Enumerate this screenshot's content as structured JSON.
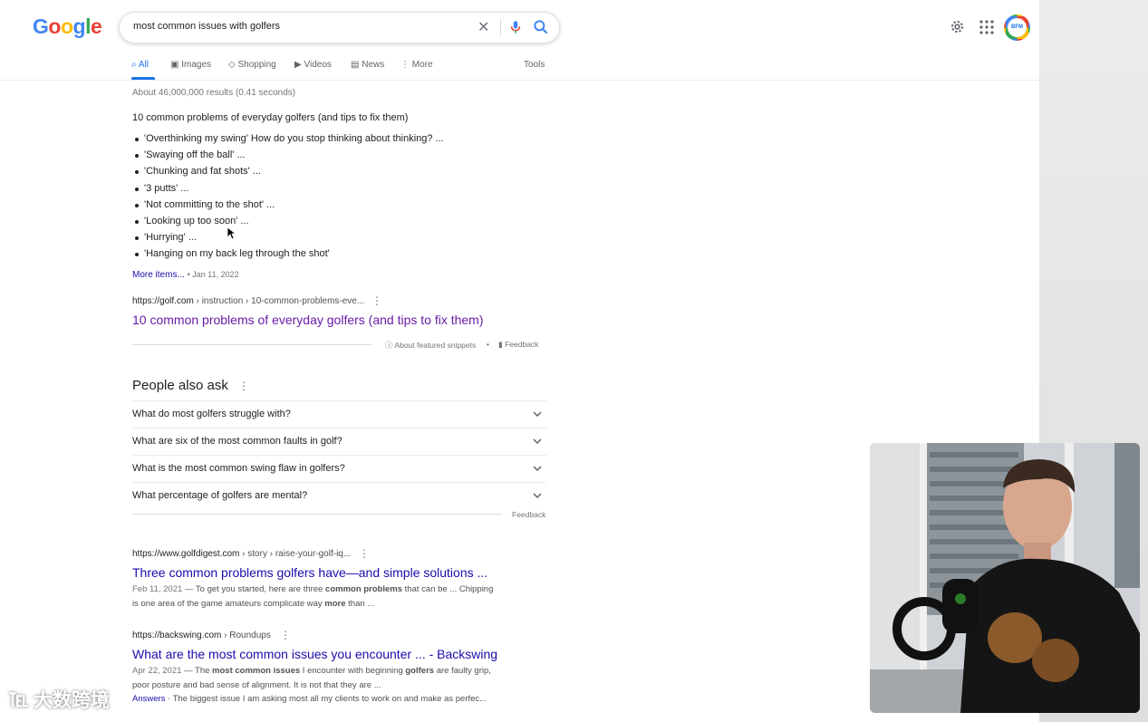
{
  "logo": {
    "letters": [
      "G",
      "o",
      "o",
      "g",
      "l",
      "e"
    ],
    "colors": [
      "#4285f4",
      "#ea4335",
      "#fbbc05",
      "#4285f4",
      "#34a853",
      "#ea4335"
    ]
  },
  "search": {
    "query": "most common issues with golfers"
  },
  "header": {
    "avatar_text": "BFM"
  },
  "tabs": [
    {
      "label": "All",
      "icon": "search-icon",
      "active": true
    },
    {
      "label": "Images",
      "icon": "image-icon"
    },
    {
      "label": "Shopping",
      "icon": "tag-icon"
    },
    {
      "label": "Videos",
      "icon": "play-icon"
    },
    {
      "label": "News",
      "icon": "newspaper-icon"
    },
    {
      "label": "More",
      "icon": "more-vert-icon"
    }
  ],
  "tools_label": "Tools",
  "stats": "About 46,000,000 results (0.41 seconds)",
  "featured_snippet": {
    "title": "10 common problems of everyday golfers (and tips to fix them)",
    "items": [
      "'Overthinking my swing' How do you stop thinking about thinking? ...",
      "'Swaying off the ball' ...",
      "'Chunking and fat shots' ...",
      "'3 putts' ...",
      "'Not committing to the shot' ...",
      "'Looking up too soon' ...",
      "'Hurrying' ...",
      "'Hanging on my back leg through the shot'"
    ],
    "more_items": "More items...",
    "date": "Jan 11, 2022",
    "cite_domain": "https://golf.com",
    "cite_path": " › instruction › 10-common-problems-eve...",
    "link_title": "10 common problems of everyday golfers (and tips to fix them)",
    "about_label": "About featured snippets",
    "feedback_label": "Feedback"
  },
  "people_also_ask": {
    "title": "People also ask",
    "questions": [
      "What do most golfers struggle with?",
      "What are six of the most common faults in golf?",
      "What is the most common swing flaw in golfers?",
      "What percentage of golfers are mental?"
    ],
    "feedback_label": "Feedback"
  },
  "results": [
    {
      "cite_domain": "https://www.golfdigest.com",
      "cite_path": " › story › raise-your-golf-iq...",
      "title": "Three common problems golfers have—and simple solutions ...",
      "date": "Feb 11, 2021",
      "line1": " — To get you started, here are three ",
      "bold1": "common problems",
      "line1b": " that can be ... Chipping",
      "line2": "is one area of the game amateurs complicate way ",
      "bold2": "more",
      "line2b": " than ..."
    },
    {
      "cite_domain": "https://backswing.com",
      "cite_path": " › Roundups",
      "title": "What are the most common issues you encounter ... - Backswing",
      "date": "Apr 22, 2021",
      "line1": " — The ",
      "bold1": "most common issues",
      "line1b": " I encounter with beginning ",
      "bold1b": "golfers",
      "line1c": " are faulty grip,",
      "line2": "poor posture and bad sense of alignment. It is not that they are ...",
      "line3_label": "Answers",
      "line3": " · The biggest issue I am asking most all my clients to work on and make as perfec..."
    }
  ],
  "watermark": "大数跨境"
}
